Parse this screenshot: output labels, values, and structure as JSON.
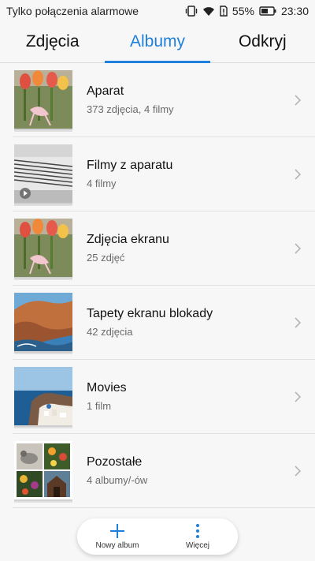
{
  "status": {
    "carrier": "Tylko połączenia alarmowe",
    "battery": "55%",
    "time": "23:30"
  },
  "tabs": [
    {
      "label": "Zdjęcia"
    },
    {
      "label": "Albumy"
    },
    {
      "label": "Odkryj"
    }
  ],
  "albums": [
    {
      "title": "Aparat",
      "subtitle": "373 zdjęcia, 4 filmy"
    },
    {
      "title": "Filmy z aparatu",
      "subtitle": "4 filmy"
    },
    {
      "title": "Zdjęcia ekranu",
      "subtitle": "25 zdjęć"
    },
    {
      "title": "Tapety ekranu blokady",
      "subtitle": "42 zdjęcia"
    },
    {
      "title": "Movies",
      "subtitle": "1 film"
    },
    {
      "title": "Pozostałe",
      "subtitle": "4 albumy/-ów"
    }
  ],
  "bottom": {
    "new_album": "Nowy album",
    "more": "Więcej"
  },
  "colors": {
    "accent": "#1f7fdc"
  }
}
